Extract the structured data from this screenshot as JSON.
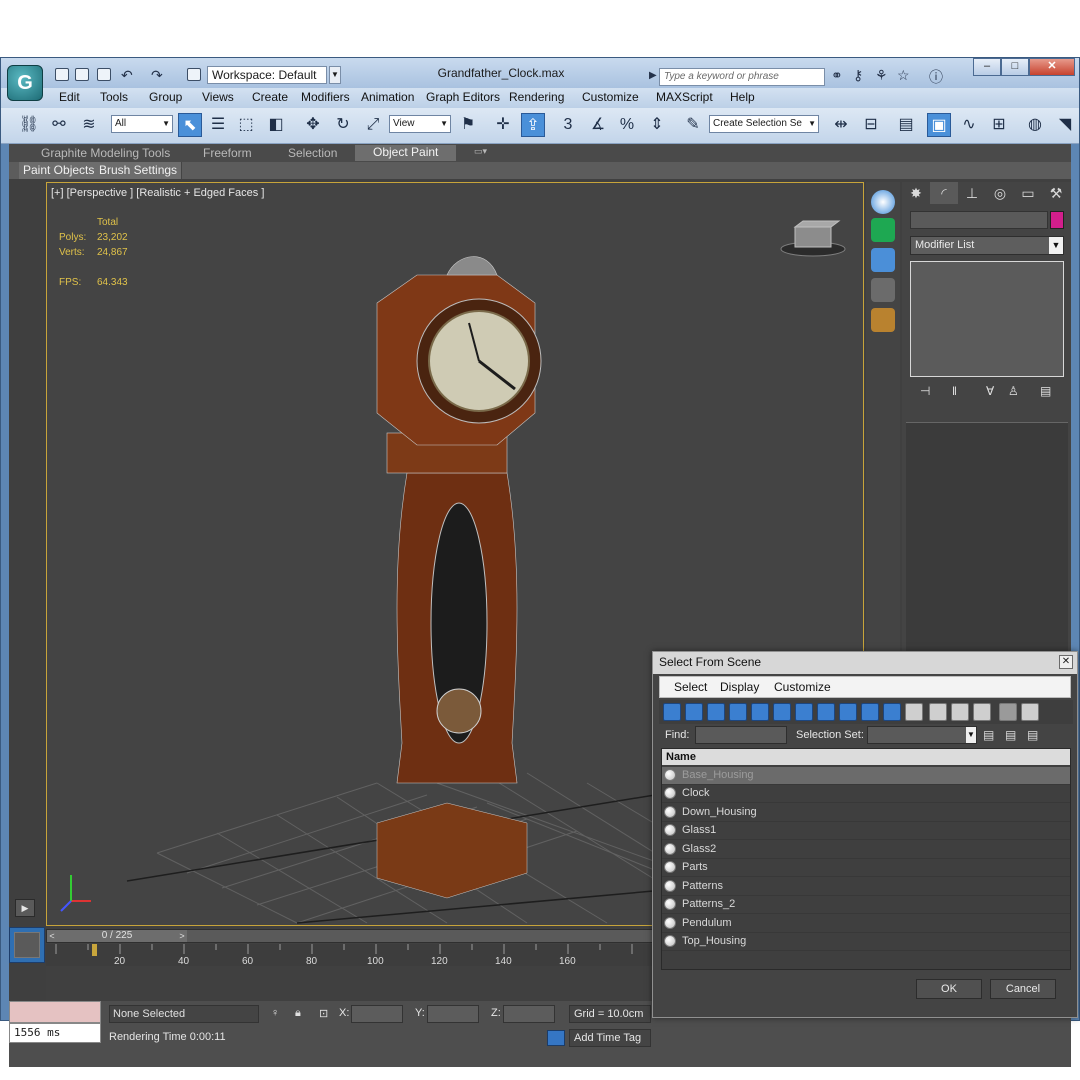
{
  "app": {
    "logo_letter": "G",
    "document_title": "Grandfather_Clock.max",
    "workspace": "Workspace: Default",
    "search_placeholder": "Type a keyword or phrase",
    "window_controls": [
      "–",
      "□",
      "✕"
    ]
  },
  "menu": [
    "Edit",
    "Tools",
    "Group",
    "Views",
    "Create",
    "Modifiers",
    "Animation",
    "Graph Editors",
    "Rendering",
    "Customize",
    "MAXScript",
    "Help"
  ],
  "toolbar": {
    "filter_value": "All",
    "coord_value": "View",
    "snap_numbers": [
      "3",
      "%"
    ],
    "selection_set_placeholder": "Create Selection Se"
  },
  "ribbon": {
    "tabs": [
      "Graphite Modeling Tools",
      "Freeform",
      "Selection",
      "Object Paint"
    ],
    "active_tab": "Object Paint",
    "sub_tabs": [
      "Paint Objects",
      "Brush Settings"
    ]
  },
  "viewport": {
    "label": "[+] [Perspective ] [Realistic + Edged Faces ]",
    "stats_header": "Total",
    "polys_label": "Polys:",
    "polys_value": "23,202",
    "verts_label": "Verts:",
    "verts_value": "24,867",
    "fps_label": "FPS:",
    "fps_value": "64.343"
  },
  "command_panel": {
    "modifier_list": "Modifier List",
    "object_color": "#d21e8c"
  },
  "timeline": {
    "position": "0 / 225",
    "ticks": [
      "20",
      "40",
      "60",
      "80",
      "100",
      "120",
      "140",
      "160"
    ]
  },
  "status": {
    "ms": "1556 ms",
    "selection": "None Selected",
    "x_label": "X:",
    "y_label": "Y:",
    "z_label": "Z:",
    "grid": "Grid = 10.0cm",
    "render_time": "Rendering Time  0:00:11",
    "add_time_tag": "Add Time Tag"
  },
  "dialog": {
    "title": "Select From Scene",
    "menu": [
      "Select",
      "Display",
      "Customize"
    ],
    "find_label": "Find:",
    "selection_set_label": "Selection Set:",
    "column_header": "Name",
    "items": [
      "Base_Housing",
      "Clock",
      "Down_Housing",
      "Glass1",
      "Glass2",
      "Parts",
      "Patterns",
      "Patterns_2",
      "Pendulum",
      "Top_Housing"
    ],
    "ok": "OK",
    "cancel": "Cancel"
  }
}
